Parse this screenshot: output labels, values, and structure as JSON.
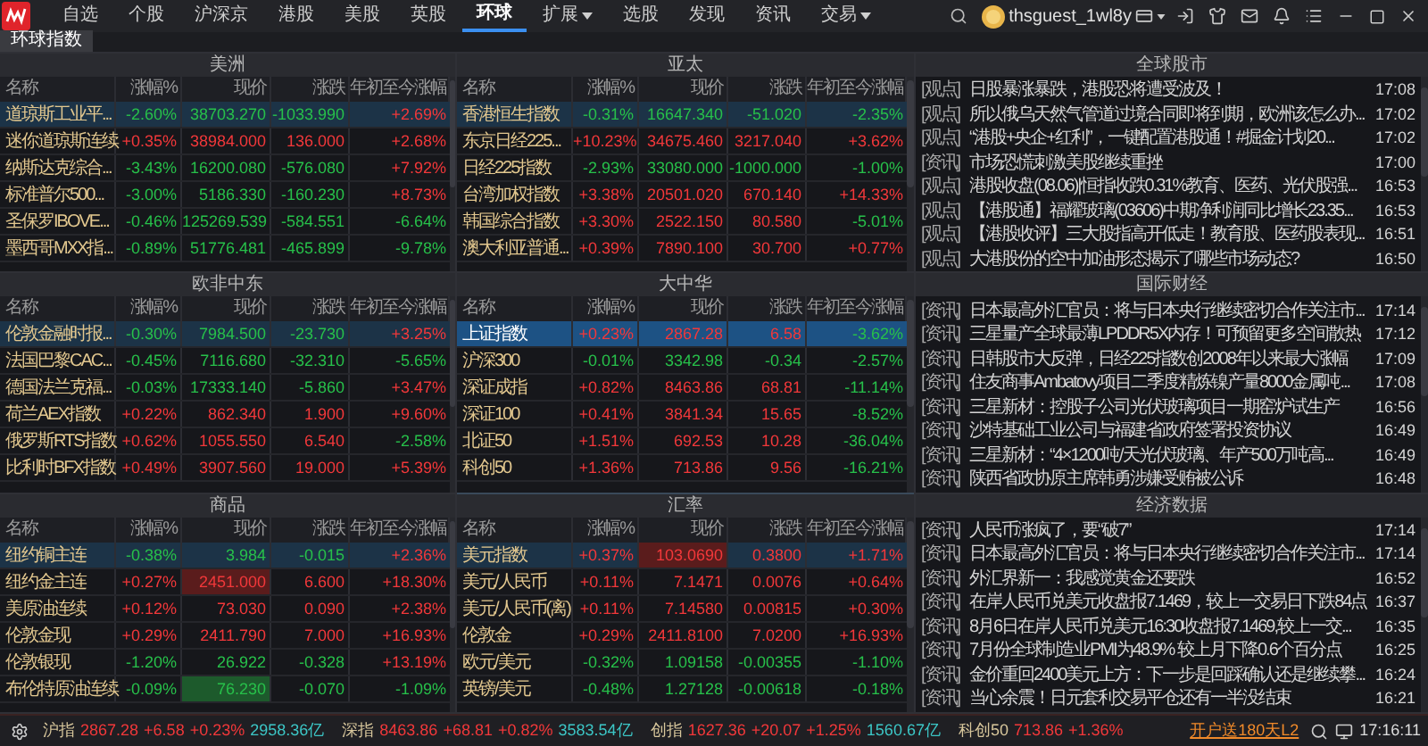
{
  "nav": {
    "tabs": [
      {
        "label": "自选",
        "selected": false,
        "dropdown": false
      },
      {
        "label": "个股",
        "selected": false,
        "dropdown": false
      },
      {
        "label": "沪深京",
        "selected": false,
        "dropdown": false
      },
      {
        "label": "港股",
        "selected": false,
        "dropdown": false
      },
      {
        "label": "美股",
        "selected": false,
        "dropdown": false
      },
      {
        "label": "英股",
        "selected": false,
        "dropdown": false
      },
      {
        "label": "环球",
        "selected": true,
        "dropdown": false
      },
      {
        "label": "扩展",
        "selected": false,
        "dropdown": true
      },
      {
        "label": "选股",
        "selected": false,
        "dropdown": false
      },
      {
        "label": "发现",
        "selected": false,
        "dropdown": false
      },
      {
        "label": "资讯",
        "selected": false,
        "dropdown": false
      },
      {
        "label": "交易",
        "selected": false,
        "dropdown": true
      }
    ],
    "username": "thsguest_1wl8y"
  },
  "sub_tabs": [
    {
      "label": "环球指数",
      "selected": true
    }
  ],
  "panels": [
    {
      "title": "美洲",
      "active": false,
      "columns": [
        "名称",
        "涨幅%",
        "现价",
        "涨跌",
        "年初至今涨幅"
      ],
      "rows": [
        {
          "name": "道琼斯工业平...",
          "pct": "-2.60%",
          "price": "38703.270",
          "change": "-1033.990",
          "ytd": "+2.69%",
          "rising": false,
          "ytd_rising": true,
          "selected": true,
          "flash": false
        },
        {
          "name": "迷你道琼斯连续",
          "pct": "+0.35%",
          "price": "38984.000",
          "change": "136.000",
          "ytd": "+2.68%",
          "rising": true,
          "ytd_rising": true,
          "selected": false,
          "flash": false
        },
        {
          "name": "纳斯达克综合...",
          "pct": "-3.43%",
          "price": "16200.080",
          "change": "-576.080",
          "ytd": "+7.92%",
          "rising": false,
          "ytd_rising": true,
          "selected": false,
          "flash": false
        },
        {
          "name": "标准普尔500...",
          "pct": "-3.00%",
          "price": "5186.330",
          "change": "-160.230",
          "ytd": "+8.73%",
          "rising": false,
          "ytd_rising": true,
          "selected": false,
          "flash": false
        },
        {
          "name": "圣保罗IBOVE...",
          "pct": "-0.46%",
          "price": "125269.539",
          "change": "-584.551",
          "ytd": "-6.64%",
          "rising": false,
          "ytd_rising": false,
          "selected": false,
          "flash": false
        },
        {
          "name": "墨西哥MXX指...",
          "pct": "-0.89%",
          "price": "51776.481",
          "change": "-465.899",
          "ytd": "-9.78%",
          "rising": false,
          "ytd_rising": false,
          "selected": false,
          "flash": false
        }
      ]
    },
    {
      "title": "亚太",
      "active": false,
      "columns": [
        "名称",
        "涨幅%",
        "现价",
        "涨跌",
        "年初至今涨幅"
      ],
      "rows": [
        {
          "name": "香港恒生指数",
          "pct": "-0.31%",
          "price": "16647.340",
          "change": "-51.020",
          "ytd": "-2.35%",
          "rising": false,
          "ytd_rising": false,
          "selected": true,
          "flash": false
        },
        {
          "name": "东京日经225...",
          "pct": "+10.23%",
          "price": "34675.460",
          "change": "3217.040",
          "ytd": "+3.62%",
          "rising": true,
          "ytd_rising": true,
          "selected": false,
          "flash": false
        },
        {
          "name": "日经225指数",
          "pct": "-2.93%",
          "price": "33080.000",
          "change": "-1000.000",
          "ytd": "-1.00%",
          "rising": false,
          "ytd_rising": false,
          "selected": false,
          "flash": false
        },
        {
          "name": "台湾加权指数",
          "pct": "+3.38%",
          "price": "20501.020",
          "change": "670.140",
          "ytd": "+14.33%",
          "rising": true,
          "ytd_rising": true,
          "selected": false,
          "flash": false
        },
        {
          "name": "韩国综合指数",
          "pct": "+3.30%",
          "price": "2522.150",
          "change": "80.580",
          "ytd": "-5.01%",
          "rising": true,
          "ytd_rising": false,
          "selected": false,
          "flash": false
        },
        {
          "name": "澳大利亚普通...",
          "pct": "+0.39%",
          "price": "7890.100",
          "change": "30.700",
          "ytd": "+0.77%",
          "rising": true,
          "ytd_rising": true,
          "selected": false,
          "flash": false
        }
      ]
    },
    {
      "title": "欧非中东",
      "active": false,
      "columns": [
        "名称",
        "涨幅%",
        "现价",
        "涨跌",
        "年初至今涨幅"
      ],
      "rows": [
        {
          "name": "伦敦金融时报...",
          "pct": "-0.30%",
          "price": "7984.500",
          "change": "-23.730",
          "ytd": "+3.25%",
          "rising": false,
          "ytd_rising": true,
          "selected": true,
          "flash": false
        },
        {
          "name": "法国巴黎CAC...",
          "pct": "-0.45%",
          "price": "7116.680",
          "change": "-32.310",
          "ytd": "-5.65%",
          "rising": false,
          "ytd_rising": false,
          "selected": false,
          "flash": false
        },
        {
          "name": "德国法兰克福...",
          "pct": "-0.03%",
          "price": "17333.140",
          "change": "-5.860",
          "ytd": "+3.47%",
          "rising": false,
          "ytd_rising": true,
          "selected": false,
          "flash": false
        },
        {
          "name": "荷兰AEX指数",
          "pct": "+0.22%",
          "price": "862.340",
          "change": "1.900",
          "ytd": "+9.60%",
          "rising": true,
          "ytd_rising": true,
          "selected": false,
          "flash": false
        },
        {
          "name": "俄罗斯RTS指数",
          "pct": "+0.62%",
          "price": "1055.550",
          "change": "6.540",
          "ytd": "-2.58%",
          "rising": true,
          "ytd_rising": false,
          "selected": false,
          "flash": false
        },
        {
          "name": "比利时BFX指数",
          "pct": "+0.49%",
          "price": "3907.560",
          "change": "19.000",
          "ytd": "+5.39%",
          "rising": true,
          "ytd_rising": true,
          "selected": false,
          "flash": false
        }
      ]
    },
    {
      "title": "大中华",
      "active": true,
      "columns": [
        "名称",
        "涨幅%",
        "现价",
        "涨跌",
        "年初至今涨幅"
      ],
      "rows": [
        {
          "name": "上证指数",
          "pct": "+0.23%",
          "price": "2867.28",
          "change": "6.58",
          "ytd": "-3.62%",
          "rising": true,
          "ytd_rising": false,
          "selected": true,
          "flash": false
        },
        {
          "name": "沪深300",
          "pct": "-0.01%",
          "price": "3342.98",
          "change": "-0.34",
          "ytd": "-2.57%",
          "rising": false,
          "ytd_rising": false,
          "selected": false,
          "flash": false
        },
        {
          "name": "深证成指",
          "pct": "+0.82%",
          "price": "8463.86",
          "change": "68.81",
          "ytd": "-11.14%",
          "rising": true,
          "ytd_rising": false,
          "selected": false,
          "flash": false
        },
        {
          "name": "深证100",
          "pct": "+0.41%",
          "price": "3841.34",
          "change": "15.65",
          "ytd": "-8.52%",
          "rising": true,
          "ytd_rising": false,
          "selected": false,
          "flash": false
        },
        {
          "name": "北证50",
          "pct": "+1.51%",
          "price": "692.53",
          "change": "10.28",
          "ytd": "-36.04%",
          "rising": true,
          "ytd_rising": false,
          "selected": false,
          "flash": false
        },
        {
          "name": "科创50",
          "pct": "+1.36%",
          "price": "713.86",
          "change": "9.56",
          "ytd": "-16.21%",
          "rising": true,
          "ytd_rising": false,
          "selected": false,
          "flash": false
        }
      ]
    },
    {
      "title": "商品",
      "active": false,
      "columns": [
        "名称",
        "涨幅%",
        "现价",
        "涨跌",
        "年初至今涨幅"
      ],
      "rows": [
        {
          "name": "纽约铜主连",
          "pct": "-0.38%",
          "price": "3.984",
          "change": "-0.015",
          "ytd": "+2.36%",
          "rising": false,
          "ytd_rising": true,
          "selected": true,
          "flash": false
        },
        {
          "name": "纽约金主连",
          "pct": "+0.27%",
          "price": "2451.000",
          "change": "6.600",
          "ytd": "+18.30%",
          "rising": true,
          "ytd_rising": true,
          "selected": false,
          "flash": true
        },
        {
          "name": "美原油连续",
          "pct": "+0.12%",
          "price": "73.030",
          "change": "0.090",
          "ytd": "+2.38%",
          "rising": true,
          "ytd_rising": true,
          "selected": false,
          "flash": false
        },
        {
          "name": "伦敦金现",
          "pct": "+0.29%",
          "price": "2411.790",
          "change": "7.000",
          "ytd": "+16.93%",
          "rising": true,
          "ytd_rising": true,
          "selected": false,
          "flash": false
        },
        {
          "name": "伦敦银现",
          "pct": "-1.20%",
          "price": "26.922",
          "change": "-0.328",
          "ytd": "+13.19%",
          "rising": false,
          "ytd_rising": true,
          "selected": false,
          "flash": false
        },
        {
          "name": "布伦特原油连续",
          "pct": "-0.09%",
          "price": "76.230",
          "change": "-0.070",
          "ytd": "-1.09%",
          "rising": false,
          "ytd_rising": false,
          "selected": false,
          "flash": true
        }
      ]
    },
    {
      "title": "汇率",
      "active": false,
      "columns": [
        "名称",
        "涨幅%",
        "现价",
        "涨跌",
        "年初至今涨幅"
      ],
      "rows": [
        {
          "name": "美元指数",
          "pct": "+0.37%",
          "price": "103.0690",
          "change": "0.3800",
          "ytd": "+1.71%",
          "rising": true,
          "ytd_rising": true,
          "selected": true,
          "flash": true
        },
        {
          "name": "美元/人民币",
          "pct": "+0.11%",
          "price": "7.1471",
          "change": "0.0076",
          "ytd": "+0.64%",
          "rising": true,
          "ytd_rising": true,
          "selected": false,
          "flash": false
        },
        {
          "name": "美元/人民币(离)",
          "pct": "+0.11%",
          "price": "7.14580",
          "change": "0.00815",
          "ytd": "+0.30%",
          "rising": true,
          "ytd_rising": true,
          "selected": false,
          "flash": false
        },
        {
          "name": "伦敦金",
          "pct": "+0.29%",
          "price": "2411.8100",
          "change": "7.0200",
          "ytd": "+16.93%",
          "rising": true,
          "ytd_rising": true,
          "selected": false,
          "flash": false
        },
        {
          "name": "欧元/美元",
          "pct": "-0.32%",
          "price": "1.09158",
          "change": "-0.00355",
          "ytd": "-1.10%",
          "rising": false,
          "ytd_rising": false,
          "selected": false,
          "flash": false
        },
        {
          "name": "英镑/美元",
          "pct": "-0.48%",
          "price": "1.27128",
          "change": "-0.00618",
          "ytd": "-0.18%",
          "rising": false,
          "ytd_rising": false,
          "selected": false,
          "flash": false
        }
      ]
    }
  ],
  "news": [
    {
      "title": "全球股市",
      "items": [
        {
          "tag": "[观点]",
          "headline": "日股暴涨暴跌，港股恐将遭受波及！",
          "time": "17:08"
        },
        {
          "tag": "[观点]",
          "headline": "所以俄乌天然气管道过境合同即将到期，欧洲该怎么办...",
          "time": "17:02"
        },
        {
          "tag": "[观点]",
          "headline": "“港股+央企+红利”，一键配置港股通！#掘金计划20...",
          "time": "17:02"
        },
        {
          "tag": "[资讯]",
          "headline": "市场恐慌刺激美股继续重挫",
          "time": "17:00"
        },
        {
          "tag": "[观点]",
          "headline": "港股收盘(08.06)|恒指收跌0.31%教育、医药、光伏股强...",
          "time": "16:53"
        },
        {
          "tag": "[观点]",
          "headline": "【港股通】福耀玻璃(03606)中期净利润同比增长23.35...",
          "time": "16:53"
        },
        {
          "tag": "[观点]",
          "headline": "【港股收评】三大股指高开低走！教育股、医药股表现...",
          "time": "16:51"
        },
        {
          "tag": "[观点]",
          "headline": "大港股份的空中加油形态揭示了哪些市场动态?",
          "time": "16:50"
        }
      ]
    },
    {
      "title": "国际财经",
      "items": [
        {
          "tag": "[资讯]",
          "headline": "日本最高外汇官员：将与日本央行继续密切合作关注市...",
          "time": "17:14"
        },
        {
          "tag": "[资讯]",
          "headline": "三星量产全球最薄LPDDR5X内存！可预留更多空间散热",
          "time": "17:12"
        },
        {
          "tag": "[资讯]",
          "headline": "日韩股市大反弹，日经225指数创2008年以来最大涨幅",
          "time": "17:09"
        },
        {
          "tag": "[资讯]",
          "headline": "住友商事Ambatovy项目二季度精炼镍产量8000金属吨...",
          "time": "17:08"
        },
        {
          "tag": "[资讯]",
          "headline": "三星新材：控股子公司光伏玻璃项目一期窑炉试生产",
          "time": "16:56"
        },
        {
          "tag": "[资讯]",
          "headline": "沙特基础工业公司与福建省政府签署投资协议",
          "time": "16:49"
        },
        {
          "tag": "[资讯]",
          "headline": "三星新材：“4×1200吨/天光伏玻璃、年产500万吨高...",
          "time": "16:49"
        },
        {
          "tag": "[资讯]",
          "headline": "陕西省政协原主席韩勇涉嫌受贿被公诉",
          "time": "16:48"
        }
      ]
    },
    {
      "title": "经济数据",
      "items": [
        {
          "tag": "[资讯]",
          "headline": "人民币涨疯了，要“破7”",
          "time": "17:14"
        },
        {
          "tag": "[资讯]",
          "headline": "日本最高外汇官员：将与日本央行继续密切合作关注市...",
          "time": "17:14"
        },
        {
          "tag": "[资讯]",
          "headline": "外汇界新一：我感觉黄金还要跌",
          "time": "16:52"
        },
        {
          "tag": "[资讯]",
          "headline": "在岸人民币兑美元收盘报7.1469，较上一交易日下跌84点",
          "time": "16:37"
        },
        {
          "tag": "[资讯]",
          "headline": "8月6日在岸人民币兑美元16:30收盘报7.1469,较上一交...",
          "time": "16:35"
        },
        {
          "tag": "[资讯]",
          "headline": "7月份全球制造业PMI为48.9% 较上月下降0.6个百分点",
          "time": "16:25"
        },
        {
          "tag": "[资讯]",
          "headline": "金价重回2400美元上方：下一步是回踩确认还是继续攀...",
          "time": "16:24"
        },
        {
          "tag": "[资讯]",
          "headline": "当心余震！日元套利交易平仓还有一半没结束",
          "time": "16:21"
        }
      ]
    }
  ],
  "status_bar": {
    "indices": [
      {
        "name": "沪指",
        "price": "2867.28",
        "change": "+6.58",
        "pct": "+0.23%",
        "amount": "2958.36亿"
      },
      {
        "name": "深指",
        "price": "8463.86",
        "change": "+68.81",
        "pct": "+0.82%",
        "amount": "3583.54亿"
      },
      {
        "name": "创指",
        "price": "1627.36",
        "change": "+20.07",
        "pct": "+1.25%",
        "amount": "1560.67亿"
      },
      {
        "name": "科创50",
        "price": "713.86",
        "pct": "+1.36%"
      }
    ],
    "promo_link": "开户送180天L2",
    "time": "17:16:11"
  }
}
